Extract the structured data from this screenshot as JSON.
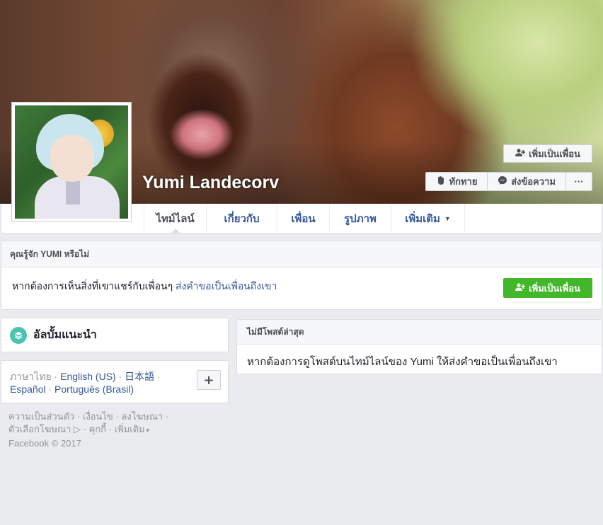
{
  "profile": {
    "name": "Yumi Landecorv"
  },
  "actions": {
    "add_friend": "เพิ่มเป็นเพื่อน",
    "poke": "ทักทาย",
    "message": "ส่งข้อความ",
    "more": "···"
  },
  "tabs": [
    {
      "label": "ไทม์ไลน์"
    },
    {
      "label": "เกี่ยวกับ"
    },
    {
      "label": "เพื่อน"
    },
    {
      "label": "รูปภาพ"
    },
    {
      "label": "เพิ่มเติม"
    }
  ],
  "know_card": {
    "title": "คุณรู้จัก YUMI หรือไม่",
    "body": "หากต้องการเห็นสิ่งที่เขาแชร์กับเพื่อนๆ",
    "link": "ส่งคำขอเป็นเพื่อนถึงเขา",
    "button": "เพิ่มเป็นเพื่อน"
  },
  "albums": {
    "title": "อัลบั้มแนะนำ"
  },
  "languages": {
    "current": "ภาษาไทย",
    "options": [
      "English (US)",
      "日本語",
      "Español",
      "Português (Brasil)"
    ],
    "more_button": "+"
  },
  "footer": {
    "links": [
      "ความเป็นส่วนตัว",
      "เงื่อนไข",
      "ลงโฆษณา",
      "ตัวเลือกโฆษณา",
      "คุกกี้",
      "เพิ่มเติม"
    ],
    "copyright": "Facebook © 2017"
  },
  "posts": {
    "title": "ไม่มีโพสต์ล่าสุด",
    "body": "หากต้องการดูโพสต์บนไทม์ไลน์ของ Yumi ให้ส่งคำขอเป็นเพื่อนถึงเขา"
  },
  "colors": {
    "page_bg": "#e9ebee",
    "link_blue": "#365899",
    "green": "#42b72a"
  }
}
